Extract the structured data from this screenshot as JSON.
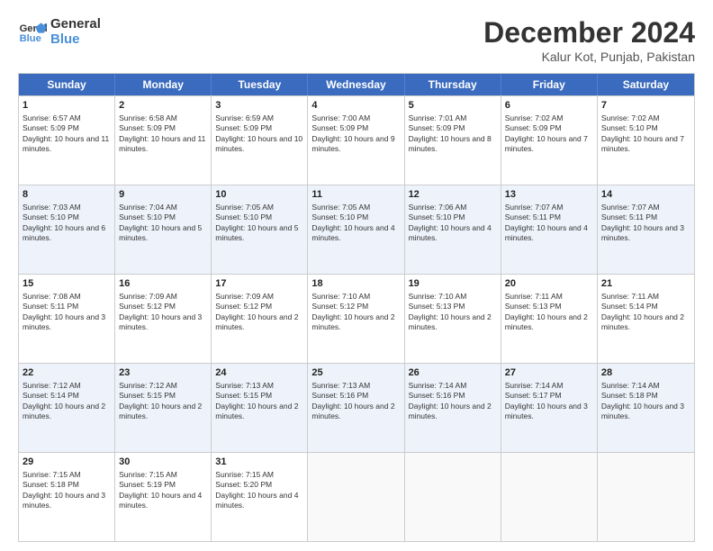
{
  "logo": {
    "text1": "General",
    "text2": "Blue"
  },
  "title": "December 2024",
  "subtitle": "Kalur Kot, Punjab, Pakistan",
  "days": [
    "Sunday",
    "Monday",
    "Tuesday",
    "Wednesday",
    "Thursday",
    "Friday",
    "Saturday"
  ],
  "rows": [
    [
      {
        "day": 1,
        "sunrise": "6:57 AM",
        "sunset": "5:09 PM",
        "daylight": "10 hours and 11 minutes."
      },
      {
        "day": 2,
        "sunrise": "6:58 AM",
        "sunset": "5:09 PM",
        "daylight": "10 hours and 11 minutes."
      },
      {
        "day": 3,
        "sunrise": "6:59 AM",
        "sunset": "5:09 PM",
        "daylight": "10 hours and 10 minutes."
      },
      {
        "day": 4,
        "sunrise": "7:00 AM",
        "sunset": "5:09 PM",
        "daylight": "10 hours and 9 minutes."
      },
      {
        "day": 5,
        "sunrise": "7:01 AM",
        "sunset": "5:09 PM",
        "daylight": "10 hours and 8 minutes."
      },
      {
        "day": 6,
        "sunrise": "7:02 AM",
        "sunset": "5:09 PM",
        "daylight": "10 hours and 7 minutes."
      },
      {
        "day": 7,
        "sunrise": "7:02 AM",
        "sunset": "5:10 PM",
        "daylight": "10 hours and 7 minutes."
      }
    ],
    [
      {
        "day": 8,
        "sunrise": "7:03 AM",
        "sunset": "5:10 PM",
        "daylight": "10 hours and 6 minutes."
      },
      {
        "day": 9,
        "sunrise": "7:04 AM",
        "sunset": "5:10 PM",
        "daylight": "10 hours and 5 minutes."
      },
      {
        "day": 10,
        "sunrise": "7:05 AM",
        "sunset": "5:10 PM",
        "daylight": "10 hours and 5 minutes."
      },
      {
        "day": 11,
        "sunrise": "7:05 AM",
        "sunset": "5:10 PM",
        "daylight": "10 hours and 4 minutes."
      },
      {
        "day": 12,
        "sunrise": "7:06 AM",
        "sunset": "5:10 PM",
        "daylight": "10 hours and 4 minutes."
      },
      {
        "day": 13,
        "sunrise": "7:07 AM",
        "sunset": "5:11 PM",
        "daylight": "10 hours and 4 minutes."
      },
      {
        "day": 14,
        "sunrise": "7:07 AM",
        "sunset": "5:11 PM",
        "daylight": "10 hours and 3 minutes."
      }
    ],
    [
      {
        "day": 15,
        "sunrise": "7:08 AM",
        "sunset": "5:11 PM",
        "daylight": "10 hours and 3 minutes."
      },
      {
        "day": 16,
        "sunrise": "7:09 AM",
        "sunset": "5:12 PM",
        "daylight": "10 hours and 3 minutes."
      },
      {
        "day": 17,
        "sunrise": "7:09 AM",
        "sunset": "5:12 PM",
        "daylight": "10 hours and 2 minutes."
      },
      {
        "day": 18,
        "sunrise": "7:10 AM",
        "sunset": "5:12 PM",
        "daylight": "10 hours and 2 minutes."
      },
      {
        "day": 19,
        "sunrise": "7:10 AM",
        "sunset": "5:13 PM",
        "daylight": "10 hours and 2 minutes."
      },
      {
        "day": 20,
        "sunrise": "7:11 AM",
        "sunset": "5:13 PM",
        "daylight": "10 hours and 2 minutes."
      },
      {
        "day": 21,
        "sunrise": "7:11 AM",
        "sunset": "5:14 PM",
        "daylight": "10 hours and 2 minutes."
      }
    ],
    [
      {
        "day": 22,
        "sunrise": "7:12 AM",
        "sunset": "5:14 PM",
        "daylight": "10 hours and 2 minutes."
      },
      {
        "day": 23,
        "sunrise": "7:12 AM",
        "sunset": "5:15 PM",
        "daylight": "10 hours and 2 minutes."
      },
      {
        "day": 24,
        "sunrise": "7:13 AM",
        "sunset": "5:15 PM",
        "daylight": "10 hours and 2 minutes."
      },
      {
        "day": 25,
        "sunrise": "7:13 AM",
        "sunset": "5:16 PM",
        "daylight": "10 hours and 2 minutes."
      },
      {
        "day": 26,
        "sunrise": "7:14 AM",
        "sunset": "5:16 PM",
        "daylight": "10 hours and 2 minutes."
      },
      {
        "day": 27,
        "sunrise": "7:14 AM",
        "sunset": "5:17 PM",
        "daylight": "10 hours and 3 minutes."
      },
      {
        "day": 28,
        "sunrise": "7:14 AM",
        "sunset": "5:18 PM",
        "daylight": "10 hours and 3 minutes."
      }
    ],
    [
      {
        "day": 29,
        "sunrise": "7:15 AM",
        "sunset": "5:18 PM",
        "daylight": "10 hours and 3 minutes."
      },
      {
        "day": 30,
        "sunrise": "7:15 AM",
        "sunset": "5:19 PM",
        "daylight": "10 hours and 4 minutes."
      },
      {
        "day": 31,
        "sunrise": "7:15 AM",
        "sunset": "5:20 PM",
        "daylight": "10 hours and 4 minutes."
      },
      null,
      null,
      null,
      null
    ]
  ]
}
